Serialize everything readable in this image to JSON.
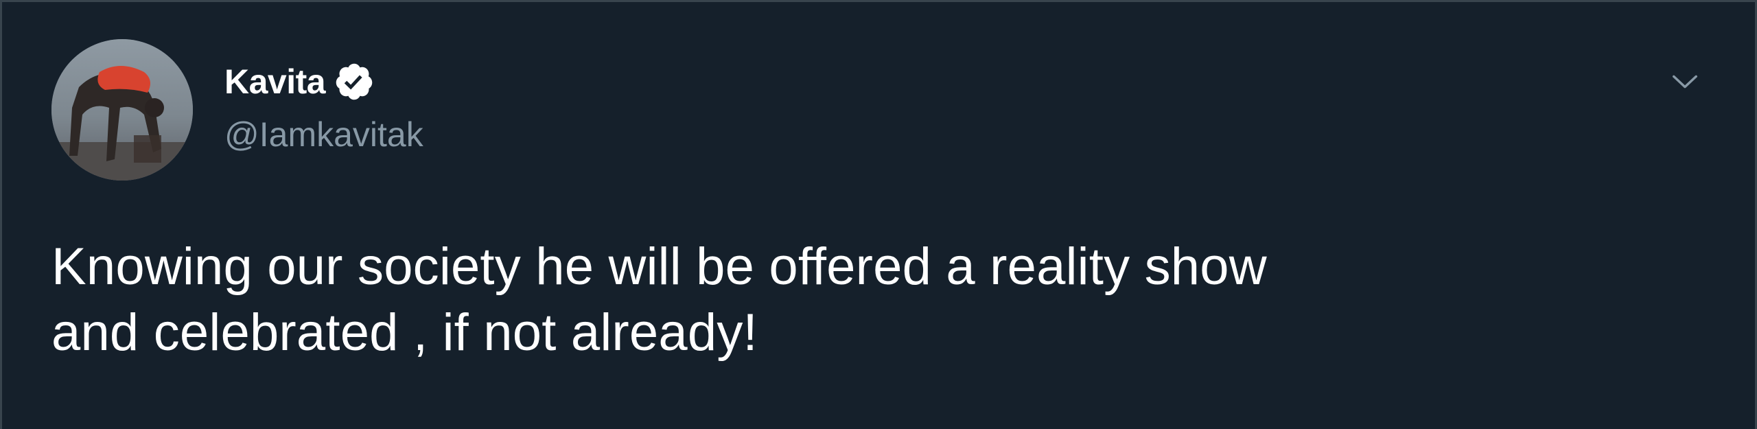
{
  "tweet": {
    "author": {
      "display_name": "Kavita",
      "handle": "@Iamkavitak",
      "verified": true,
      "avatar_icon": "profile-photo"
    },
    "text_lines": [
      "Knowing our society he will be offered a reality show",
      "and celebrated , if not already!"
    ],
    "menu_icon": "chevron-down-icon"
  },
  "colors": {
    "background": "#15202b",
    "border": "#38444d",
    "text_primary": "#ffffff",
    "text_secondary": "#8899a6"
  }
}
